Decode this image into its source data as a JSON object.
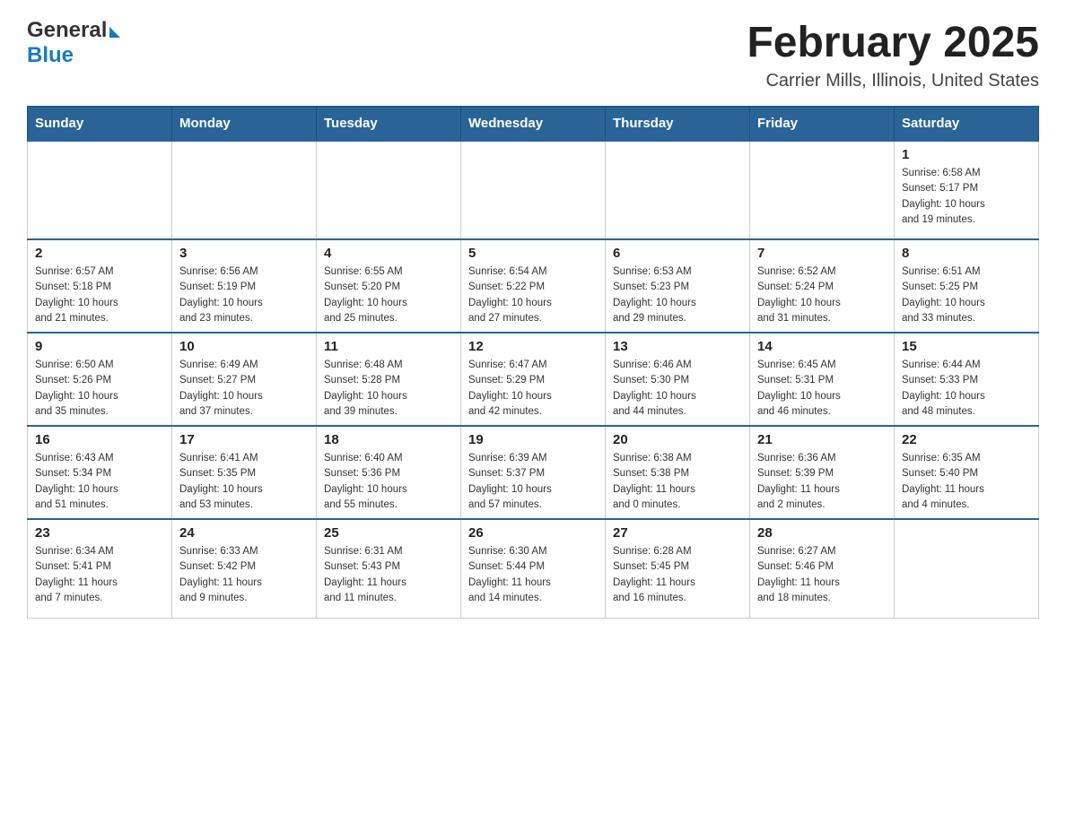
{
  "logo": {
    "line1_black": "General",
    "line1_blue_arrow": "▶",
    "line2_blue": "Blue"
  },
  "title": "February 2025",
  "subtitle": "Carrier Mills, Illinois, United States",
  "days_of_week": [
    "Sunday",
    "Monday",
    "Tuesday",
    "Wednesday",
    "Thursday",
    "Friday",
    "Saturday"
  ],
  "weeks": [
    [
      {
        "day": "",
        "info": ""
      },
      {
        "day": "",
        "info": ""
      },
      {
        "day": "",
        "info": ""
      },
      {
        "day": "",
        "info": ""
      },
      {
        "day": "",
        "info": ""
      },
      {
        "day": "",
        "info": ""
      },
      {
        "day": "1",
        "info": "Sunrise: 6:58 AM\nSunset: 5:17 PM\nDaylight: 10 hours\nand 19 minutes."
      }
    ],
    [
      {
        "day": "2",
        "info": "Sunrise: 6:57 AM\nSunset: 5:18 PM\nDaylight: 10 hours\nand 21 minutes."
      },
      {
        "day": "3",
        "info": "Sunrise: 6:56 AM\nSunset: 5:19 PM\nDaylight: 10 hours\nand 23 minutes."
      },
      {
        "day": "4",
        "info": "Sunrise: 6:55 AM\nSunset: 5:20 PM\nDaylight: 10 hours\nand 25 minutes."
      },
      {
        "day": "5",
        "info": "Sunrise: 6:54 AM\nSunset: 5:22 PM\nDaylight: 10 hours\nand 27 minutes."
      },
      {
        "day": "6",
        "info": "Sunrise: 6:53 AM\nSunset: 5:23 PM\nDaylight: 10 hours\nand 29 minutes."
      },
      {
        "day": "7",
        "info": "Sunrise: 6:52 AM\nSunset: 5:24 PM\nDaylight: 10 hours\nand 31 minutes."
      },
      {
        "day": "8",
        "info": "Sunrise: 6:51 AM\nSunset: 5:25 PM\nDaylight: 10 hours\nand 33 minutes."
      }
    ],
    [
      {
        "day": "9",
        "info": "Sunrise: 6:50 AM\nSunset: 5:26 PM\nDaylight: 10 hours\nand 35 minutes."
      },
      {
        "day": "10",
        "info": "Sunrise: 6:49 AM\nSunset: 5:27 PM\nDaylight: 10 hours\nand 37 minutes."
      },
      {
        "day": "11",
        "info": "Sunrise: 6:48 AM\nSunset: 5:28 PM\nDaylight: 10 hours\nand 39 minutes."
      },
      {
        "day": "12",
        "info": "Sunrise: 6:47 AM\nSunset: 5:29 PM\nDaylight: 10 hours\nand 42 minutes."
      },
      {
        "day": "13",
        "info": "Sunrise: 6:46 AM\nSunset: 5:30 PM\nDaylight: 10 hours\nand 44 minutes."
      },
      {
        "day": "14",
        "info": "Sunrise: 6:45 AM\nSunset: 5:31 PM\nDaylight: 10 hours\nand 46 minutes."
      },
      {
        "day": "15",
        "info": "Sunrise: 6:44 AM\nSunset: 5:33 PM\nDaylight: 10 hours\nand 48 minutes."
      }
    ],
    [
      {
        "day": "16",
        "info": "Sunrise: 6:43 AM\nSunset: 5:34 PM\nDaylight: 10 hours\nand 51 minutes."
      },
      {
        "day": "17",
        "info": "Sunrise: 6:41 AM\nSunset: 5:35 PM\nDaylight: 10 hours\nand 53 minutes."
      },
      {
        "day": "18",
        "info": "Sunrise: 6:40 AM\nSunset: 5:36 PM\nDaylight: 10 hours\nand 55 minutes."
      },
      {
        "day": "19",
        "info": "Sunrise: 6:39 AM\nSunset: 5:37 PM\nDaylight: 10 hours\nand 57 minutes."
      },
      {
        "day": "20",
        "info": "Sunrise: 6:38 AM\nSunset: 5:38 PM\nDaylight: 11 hours\nand 0 minutes."
      },
      {
        "day": "21",
        "info": "Sunrise: 6:36 AM\nSunset: 5:39 PM\nDaylight: 11 hours\nand 2 minutes."
      },
      {
        "day": "22",
        "info": "Sunrise: 6:35 AM\nSunset: 5:40 PM\nDaylight: 11 hours\nand 4 minutes."
      }
    ],
    [
      {
        "day": "23",
        "info": "Sunrise: 6:34 AM\nSunset: 5:41 PM\nDaylight: 11 hours\nand 7 minutes."
      },
      {
        "day": "24",
        "info": "Sunrise: 6:33 AM\nSunset: 5:42 PM\nDaylight: 11 hours\nand 9 minutes."
      },
      {
        "day": "25",
        "info": "Sunrise: 6:31 AM\nSunset: 5:43 PM\nDaylight: 11 hours\nand 11 minutes."
      },
      {
        "day": "26",
        "info": "Sunrise: 6:30 AM\nSunset: 5:44 PM\nDaylight: 11 hours\nand 14 minutes."
      },
      {
        "day": "27",
        "info": "Sunrise: 6:28 AM\nSunset: 5:45 PM\nDaylight: 11 hours\nand 16 minutes."
      },
      {
        "day": "28",
        "info": "Sunrise: 6:27 AM\nSunset: 5:46 PM\nDaylight: 11 hours\nand 18 minutes."
      },
      {
        "day": "",
        "info": ""
      }
    ]
  ]
}
